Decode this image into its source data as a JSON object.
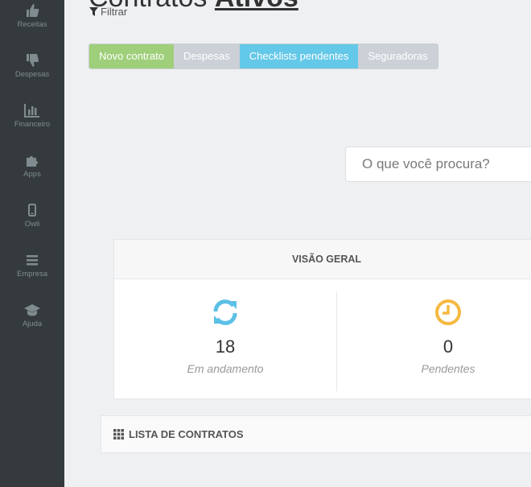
{
  "sidebar": {
    "items": [
      {
        "label": "Receitas",
        "icon": "thumbs-up-icon"
      },
      {
        "label": "Despesas",
        "icon": "thumbs-down-icon"
      },
      {
        "label": "Financeiro",
        "icon": "bar-chart-icon"
      },
      {
        "label": "Apps",
        "icon": "puzzle-icon"
      },
      {
        "label": "Owli",
        "icon": "mobile-icon"
      },
      {
        "label": "Empresa",
        "icon": "bars-icon"
      },
      {
        "label": "Ajuda",
        "icon": "graduation-cap-icon"
      }
    ]
  },
  "header": {
    "title_prefix": "Contratos",
    "title_accent": "Ativos",
    "filter_label": "Filtrar"
  },
  "toolbar": {
    "buttons": [
      {
        "label": "Novo contrato",
        "color": "#9fcf7a"
      },
      {
        "label": "Despesas",
        "color": "#ccd1d7"
      },
      {
        "label": "Checklists pendentes",
        "color": "#64c8e8"
      },
      {
        "label": "Seguradoras",
        "color": "#ccd1d7"
      }
    ]
  },
  "search": {
    "placeholder": "O que você procura?"
  },
  "overview": {
    "title": "VISÃO GERAL",
    "stats": [
      {
        "value": "18",
        "label": "Em andamento",
        "icon": "refresh-icon",
        "color": "#5bc0e6"
      },
      {
        "value": "0",
        "label": "Pendentes",
        "icon": "clock-icon",
        "color": "#f5b942"
      }
    ]
  },
  "contracts_list": {
    "title": "LISTA DE CONTRATOS",
    "icon": "grid-icon"
  }
}
